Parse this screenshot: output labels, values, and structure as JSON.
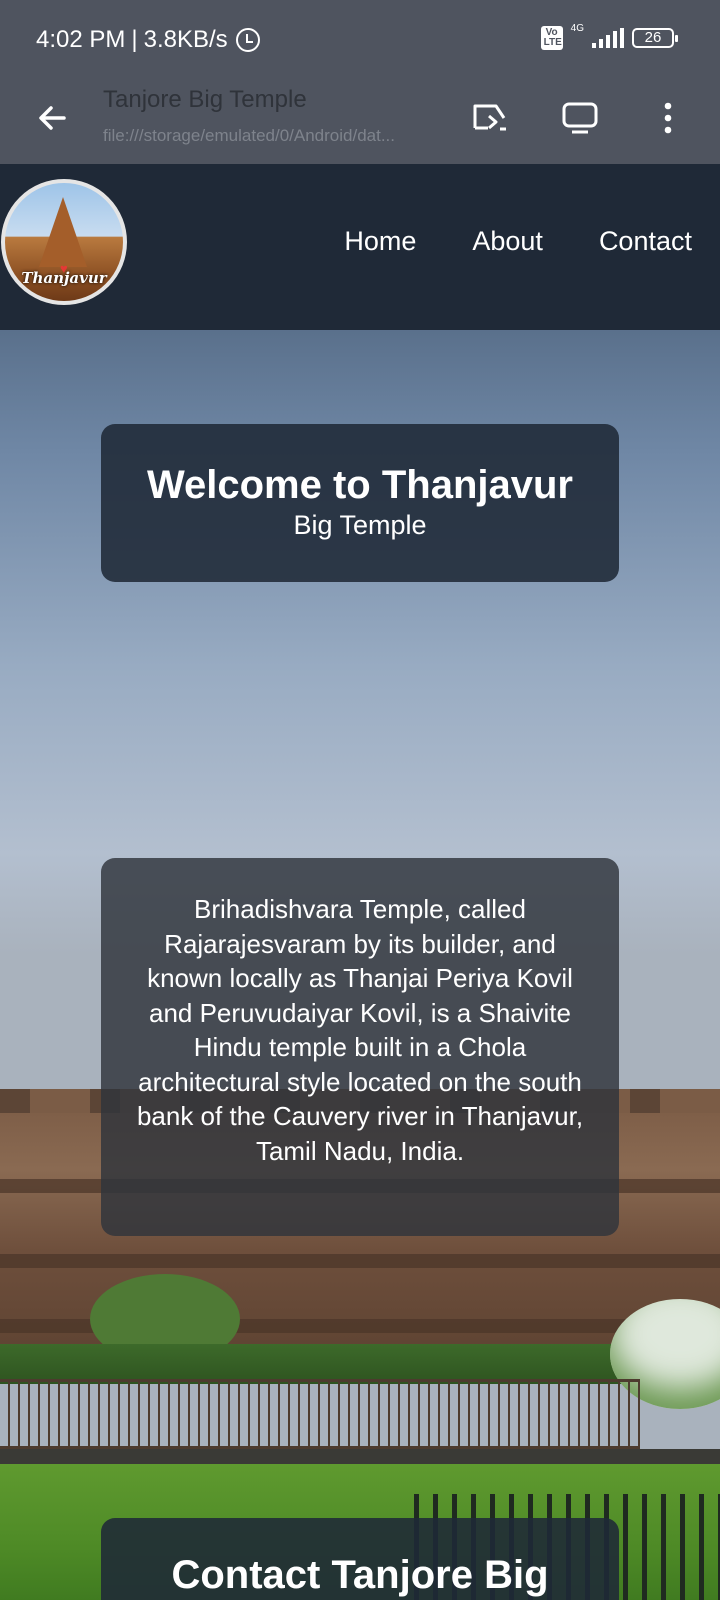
{
  "status_bar": {
    "time": "4:02 PM",
    "separator": "|",
    "speed": "3.8KB/s",
    "volte": "Vo LTE",
    "network": "4G",
    "battery": "26"
  },
  "browser": {
    "title": "Tanjore Big Temple",
    "url": "file:///storage/emulated/0/Android/dat..."
  },
  "site": {
    "logo_text": "Thanjavur",
    "nav": [
      "Home",
      "About",
      "Contact"
    ],
    "welcome": {
      "title": "Welcome to Thanjavur",
      "subtitle": "Big Temple"
    },
    "about_text": "Brihadishvara Temple, called Rajarajesvaram by its builder, and known locally as Thanjai Periya Kovil and Peruvudaiyar Kovil, is a Shaivite Hindu temple built in a Chola architectural style located on the south bank of the Cauvery river in Thanjavur, Tamil Nadu, India.",
    "contact_title": "Contact Tanjore Big"
  },
  "icons": {
    "status": [
      "alarm-icon",
      "volte-icon",
      "signal-icon",
      "battery-icon"
    ],
    "toolbar": [
      "back-arrow-icon",
      "cast-icon",
      "desktop-mode-icon",
      "more-vert-icon"
    ]
  }
}
